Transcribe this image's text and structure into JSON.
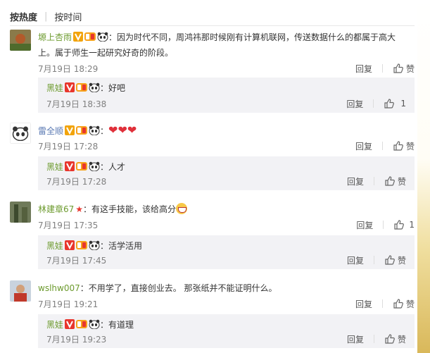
{
  "sort_bar": {
    "hot": "按热度",
    "time": "按时间"
  },
  "actions": {
    "reply": "回复",
    "like": "赞"
  },
  "comments": [
    {
      "user": "塬上杏雨",
      "text_line1": "：因为时代不同，周鸿祎那时候刚有计算机联网，传送数据什么的都属于高大",
      "text_line2": "上。属于师生一起研究好奇的阶段。",
      "time": "7月19日 18:29",
      "like_text": "赞",
      "reply": {
        "user": "黑娃",
        "text": "：好吧",
        "time": "7月19日 18:38",
        "like_count": "1"
      }
    },
    {
      "user": "雷全顺",
      "text": "：",
      "hearts": "❤❤❤",
      "time": "7月19日 17:28",
      "like_text": "赞",
      "reply": {
        "user": "黑娃",
        "text": "：人才",
        "time": "7月19日 17:28",
        "like_text": "赞"
      }
    },
    {
      "user": "林建章67",
      "text": "：有这手技能，该给高分",
      "time": "7月19日 17:35",
      "like_count": "1",
      "reply": {
        "user": "黑娃",
        "text": "：活学活用",
        "time": "7月19日 17:45",
        "like_text": "赞"
      }
    },
    {
      "user": "wslhw007",
      "text": "：不用学了，直接创业去。 那张纸并不能证明什么。",
      "time": "7月19日 19:21",
      "like_text": "赞",
      "reply": {
        "user": "黑娃",
        "text": "：有道理",
        "time": "7月19日 19:23",
        "like_text": "赞"
      }
    }
  ],
  "colors": {
    "username": "#eb7350",
    "reply_bg": "#f2f2f5",
    "meta": "#808080"
  }
}
